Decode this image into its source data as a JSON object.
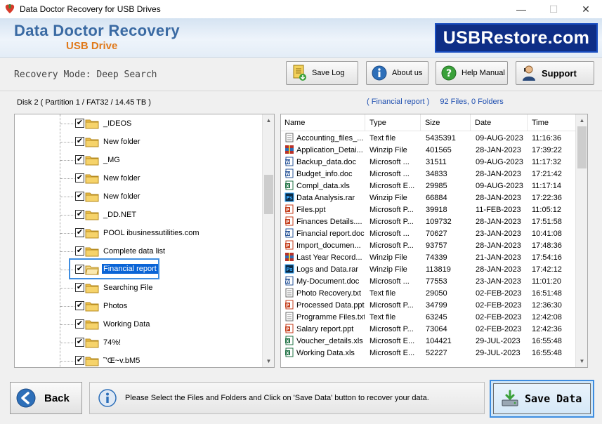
{
  "window": {
    "title": "Data Doctor Recovery for USB Drives",
    "minimize": "—",
    "maximize": "☐",
    "close": "✕"
  },
  "banner": {
    "brand_line1": "Data Doctor Recovery",
    "brand_line2": "USB Drive",
    "logo_text": "USBRestore.com"
  },
  "toolbar": {
    "mode_text": "Recovery Mode: Deep Search",
    "save_log": "Save Log",
    "about_us": "About us",
    "help_manual": "Help Manual",
    "support": "Support"
  },
  "disk_label": "Disk 2 ( Partition 1 / FAT32 / 14.45 TB )",
  "summary": {
    "folder": "( Financial report )",
    "counts": "92 Files, 0 Folders"
  },
  "tree": {
    "items": [
      {
        "label": "_IDEOS",
        "checked": true
      },
      {
        "label": "New folder",
        "checked": true
      },
      {
        "label": "_MG",
        "checked": true
      },
      {
        "label": "New folder",
        "checked": true
      },
      {
        "label": "New folder",
        "checked": true
      },
      {
        "label": "_DD.NET",
        "checked": true
      },
      {
        "label": "POOL ibusinessutilities.com",
        "checked": true
      },
      {
        "label": "Complete data list",
        "checked": true
      },
      {
        "label": "Financial report",
        "checked": true,
        "selected": true
      },
      {
        "label": "Searching File",
        "checked": true
      },
      {
        "label": "Photos",
        "checked": true
      },
      {
        "label": "Working Data",
        "checked": true
      },
      {
        "label": "74%!",
        "checked": true
      },
      {
        "label": "˜'Œ~v.bM5",
        "checked": true
      }
    ]
  },
  "files": {
    "columns": [
      "Name",
      "Type",
      "Size",
      "Date",
      "Time"
    ],
    "rows": [
      {
        "icon": "text-file-icon",
        "name": "Accounting_files_...",
        "type": "Text file",
        "size": "5435391",
        "date": "09-AUG-2023",
        "time": "11:16:36"
      },
      {
        "icon": "winzip-file-icon",
        "name": "Application_Detai...",
        "type": "Winzip File",
        "size": "401565",
        "date": "28-JAN-2023",
        "time": "17:39:22"
      },
      {
        "icon": "word-file-icon",
        "name": "Backup_data.doc",
        "type": "Microsoft ...",
        "size": "31511",
        "date": "09-AUG-2023",
        "time": "11:17:32"
      },
      {
        "icon": "word-file-icon",
        "name": "Budget_info.doc",
        "type": "Microsoft ...",
        "size": "34833",
        "date": "28-JAN-2023",
        "time": "17:21:42"
      },
      {
        "icon": "excel-file-icon",
        "name": "Compl_data.xls",
        "type": "Microsoft E...",
        "size": "29985",
        "date": "09-AUG-2023",
        "time": "11:17:14"
      },
      {
        "icon": "photoshop-file-icon",
        "name": "Data Analysis.rar",
        "type": "Winzip File",
        "size": "66884",
        "date": "28-JAN-2023",
        "time": "17:22:36"
      },
      {
        "icon": "powerpoint-file-icon",
        "name": "Files.ppt",
        "type": "Microsoft P...",
        "size": "39918",
        "date": "11-FEB-2023",
        "time": "11:05:12"
      },
      {
        "icon": "powerpoint-file-icon",
        "name": "Finances Details....",
        "type": "Microsoft P...",
        "size": "109732",
        "date": "28-JAN-2023",
        "time": "17:51:58"
      },
      {
        "icon": "word-file-icon",
        "name": "Financial report.doc",
        "type": "Microsoft ...",
        "size": "70627",
        "date": "23-JAN-2023",
        "time": "10:41:08"
      },
      {
        "icon": "powerpoint-file-icon",
        "name": "Import_documen...",
        "type": "Microsoft P...",
        "size": "93757",
        "date": "28-JAN-2023",
        "time": "17:48:36"
      },
      {
        "icon": "winzip-file-icon",
        "name": "Last Year Record...",
        "type": "Winzip File",
        "size": "74339",
        "date": "21-JAN-2023",
        "time": "17:54:16"
      },
      {
        "icon": "photoshop-file-icon",
        "name": "Logs and Data.rar",
        "type": "Winzip File",
        "size": "113819",
        "date": "28-JAN-2023",
        "time": "17:42:12"
      },
      {
        "icon": "word-file-icon",
        "name": "My-Document.doc",
        "type": "Microsoft ...",
        "size": "77553",
        "date": "23-JAN-2023",
        "time": "11:01:20"
      },
      {
        "icon": "text-file-icon",
        "name": "Photo Recovery.txt",
        "type": "Text file",
        "size": "29050",
        "date": "02-FEB-2023",
        "time": "16:51:48"
      },
      {
        "icon": "powerpoint-file-icon",
        "name": "Processed Data.ppt",
        "type": "Microsoft P...",
        "size": "34799",
        "date": "02-FEB-2023",
        "time": "12:36:30"
      },
      {
        "icon": "text-file-icon",
        "name": "Programme Files.txt",
        "type": "Text file",
        "size": "63245",
        "date": "02-FEB-2023",
        "time": "12:42:08"
      },
      {
        "icon": "powerpoint-file-icon",
        "name": "Salary report.ppt",
        "type": "Microsoft P...",
        "size": "73064",
        "date": "02-FEB-2023",
        "time": "12:42:36"
      },
      {
        "icon": "excel-file-icon",
        "name": "Voucher_details.xls",
        "type": "Microsoft E...",
        "size": "104421",
        "date": "29-JUL-2023",
        "time": "16:55:48"
      },
      {
        "icon": "excel-file-icon",
        "name": "Working Data.xls",
        "type": "Microsoft E...",
        "size": "52227",
        "date": "29-JUL-2023",
        "time": "16:55:48"
      }
    ]
  },
  "bottom": {
    "back": "Back",
    "message": "Please Select the Files and Folders and Click on 'Save Data' button to recover your data.",
    "save_data": "Save Data"
  },
  "colors": {
    "accent": "#0a64d6",
    "focus_border": "#3e8de0",
    "brand_blue": "#3a6aa3",
    "brand_orange": "#e07a1c",
    "logo_bg": "#0e2e86"
  }
}
